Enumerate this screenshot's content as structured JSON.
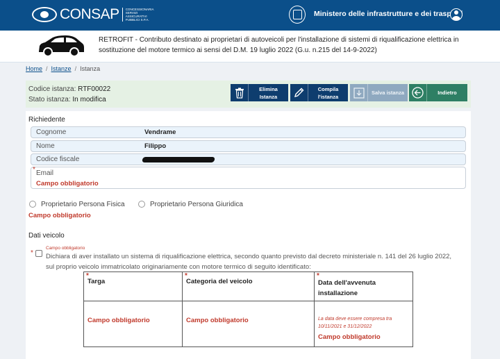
{
  "topbar": {
    "logo_text": "CONSAP",
    "logo_subtitle": "CONCESSIONARIA SERVIZI ASSICURATIVI PUBBLICI S.P.A.",
    "ministry": "Ministero delle infrastrutture e dei trasporti"
  },
  "header": {
    "title": "RETROFIT - Contributo destinato ai proprietari di autoveicoli per l'installazione di sistemi di riqualificazione elettrica in sostituzione del motore termico ai sensi del D.M. 19 luglio 2022 (G.u. n.215 del 14-9-2022)"
  },
  "breadcrumb": [
    "Home",
    "Istanze",
    "Istanza"
  ],
  "status": {
    "codice_label": "Codice istanza:",
    "codice_value": "RTF00022",
    "stato_label": "Stato istanza:",
    "stato_value": "In modifica"
  },
  "actions": {
    "elimina": [
      "Elimina",
      "Istanza"
    ],
    "compila": [
      "Compila",
      "l'istanza"
    ],
    "salva": "Salva istanza",
    "indietro": "Indietro"
  },
  "richiedente": {
    "title": "Richiedente",
    "cognome_label": "Cognome",
    "cognome_value": "Vendrame",
    "nome_label": "Nome",
    "nome_value": "Filippo",
    "cf_label": "Codice fiscale",
    "email_label": "Email",
    "email_error": "Campo obbligatorio"
  },
  "proprietario": {
    "fisica": "Proprietario Persona Fisica",
    "giuridica": "Proprietario Persona Giuridica",
    "error": "Campo obbligatorio"
  },
  "veicolo": {
    "title": "Dati veicolo",
    "checkbox_error": "Campo obbligatorio",
    "declaration": "Dichiara di aver installato un sistema di riqualificazione elettrica, secondo quanto previsto dal decreto ministeriale n. 141 del 26 luglio 2022, sul proprio veicolo immatricolato originariamente con motore termico di seguito identificato:",
    "col_targa": "Targa",
    "col_categoria": "Categoria del veicolo",
    "col_data": "Data dell'avvenuta installazione",
    "err_targa": "Campo obbligatorio",
    "err_categoria": "Campo obbligatorio",
    "date_note": "La data deve essere compresa tra 10/11/2021 e 31/12/2022",
    "err_data": "Campo obbligatorio"
  },
  "colors": {
    "primary": "#0b4f8a",
    "dark_button": "#0e3d6e",
    "back_button": "#2e7f64",
    "error": "#c0392b"
  }
}
